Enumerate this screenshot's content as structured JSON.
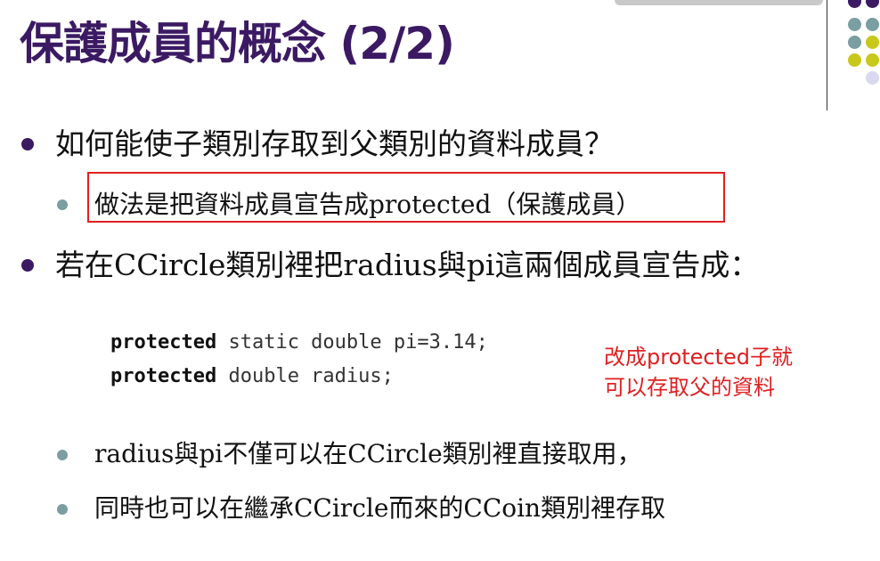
{
  "title": "保護成員的概念 (2/2)",
  "bullets": {
    "q1": "如何能使子類別存取到父類別的資料成員？",
    "q1_sub": "做法是把資料成員宣告成protected（保護成員）",
    "q2": "若在CCircle類別裡把radius與pi這兩個成員宣告成：",
    "sub_a": "radius與pi不僅可以在CCircle類別裡直接取用，",
    "sub_b": "同時也可以在繼承CCircle而來的CCoin類別裡存取"
  },
  "code": {
    "line1_kw": "protected",
    "line1_rest": " static double pi=3.14;",
    "line2_kw": "protected",
    "line2_rest": " double radius;"
  },
  "note": {
    "line1": "改成protected子就",
    "line2": "可以存取父的資料"
  },
  "colors": {
    "title": "#3b1a63",
    "accent_red": "#e02020",
    "dot_purple": "#3b1a63",
    "dot_teal": "#7a9ea1",
    "dot_olive": "#c8c81a",
    "dot_lavender": "#d8d8ee"
  }
}
